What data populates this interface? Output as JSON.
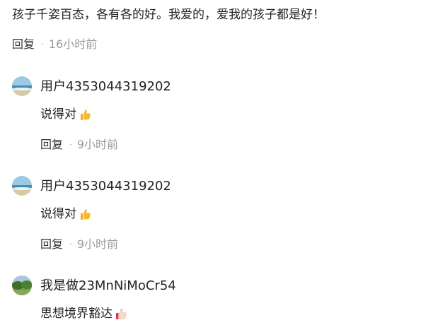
{
  "top_comment": {
    "text": "孩子千姿百态，各有各的好。我爱的，爱我的孩子都是好！",
    "reply_label": "回复",
    "separator": "·",
    "time": "16小时前"
  },
  "replies": [
    {
      "username": "用户4353044319202",
      "text": "说得对",
      "emoji": "thumbs-up-icon",
      "reply_label": "回复",
      "separator": "·",
      "time": "9小时前"
    },
    {
      "username": "用户4353044319202",
      "text": "说得对",
      "emoji": "thumbs-up-icon",
      "reply_label": "回复",
      "separator": "·",
      "time": "9小时前"
    },
    {
      "username": "我是做23MnNiMoCr54",
      "text": "思想境界豁达",
      "emoji": "thumbs-up-icon"
    }
  ],
  "colors": {
    "text": "#222222",
    "muted": "#9a9a9a",
    "emoji_yellow": "#f5b82e"
  }
}
